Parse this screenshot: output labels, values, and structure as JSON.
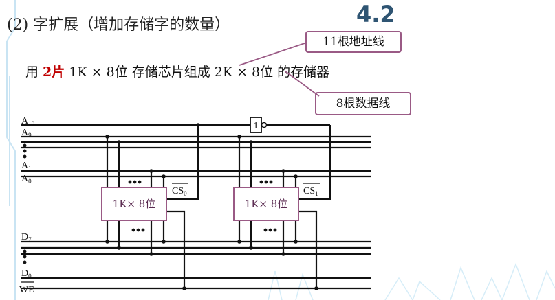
{
  "heading": "(2) 字扩展（增加存储字的数量）",
  "section_number": "4.2",
  "sentence": {
    "pre": "用 ",
    "highlight": "2片",
    "post": " 1K × 8位 存储芯片组成 2K × 8位 的存储器"
  },
  "callouts": {
    "address": "11根地址线",
    "data": "8根数据线"
  },
  "signals": {
    "a10": "A",
    "a10_sub": "10",
    "a9": "A",
    "a9_sub": "9",
    "a1": "A",
    "a1_sub": "1",
    "a0": "A",
    "a0_sub": "0",
    "d7": "D",
    "d7_sub": "7",
    "d0": "D",
    "d0_sub": "0",
    "we": "WE",
    "cs0": "CS",
    "cs0_sub": "0",
    "cs1": "CS",
    "cs1_sub": "1"
  },
  "chips": [
    "1K× 8位",
    "1K× 8位"
  ],
  "inverter": "1",
  "colors": {
    "accent_title": "#2f5573",
    "highlight": "#c00000",
    "chip_border": "#9a5a85"
  }
}
